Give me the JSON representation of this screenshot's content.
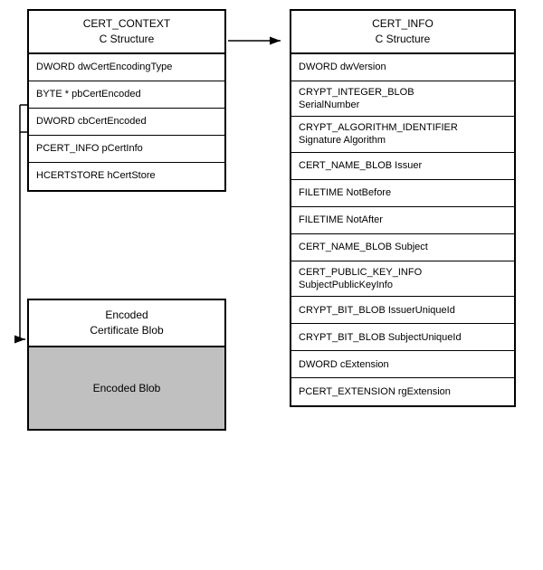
{
  "left": {
    "cert_context": {
      "title_line1": "CERT_CONTEXT",
      "title_line2": "C Structure",
      "rows": [
        "DWORD dwCertEncodingType",
        "BYTE *  pbCertEncoded",
        "DWORD  cbCertEncoded",
        "PCERT_INFO  pCertInfo",
        "HCERTSTORE  hCertStore"
      ]
    },
    "encoded_blob": {
      "title_line1": "Encoded",
      "title_line2": "Certificate Blob",
      "content": "Encoded Blob"
    }
  },
  "right": {
    "cert_info": {
      "title_line1": "CERT_INFO",
      "title_line2": "C Structure",
      "rows": [
        "DWORD dwVersion",
        "CRYPT_INTEGER_BLOB\nSerialNumber",
        "CRYPT_ALGORITHM_IDENTIFIER\nSignature Algorithm",
        "CERT_NAME_BLOB Issuer",
        "FILETIME NotBefore",
        "FILETIME NotAfter",
        "CERT_NAME_BLOB Subject",
        "CERT_PUBLIC_KEY_INFO\nSubjectPublicKeyInfo",
        "CRYPT_BIT_BLOB IssuerUniqueId",
        "CRYPT_BIT_BLOB SubjectUniqueId",
        "DWORD cExtension",
        "PCERT_EXTENSION rgExtension"
      ]
    }
  }
}
